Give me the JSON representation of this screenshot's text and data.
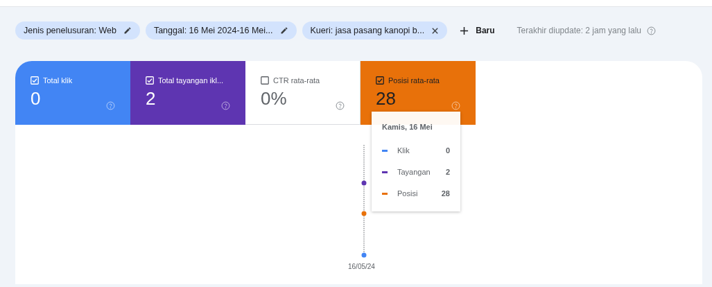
{
  "filters": [
    {
      "label": "Jenis penelusuran: Web",
      "kind": "edit"
    },
    {
      "label": "Tanggal: 16 Mei 2024-16 Mei...",
      "kind": "edit"
    },
    {
      "label": "Kueri: jasa pasang kanopi b...",
      "kind": "remove"
    }
  ],
  "new_button": "Baru",
  "last_updated": "Terakhir diupdate: 2 jam yang lalu",
  "metrics": [
    {
      "label": "Total klik",
      "value": "0",
      "checked": true,
      "color": "#4285f4"
    },
    {
      "label": "Total tayangan ikl...",
      "value": "2",
      "checked": true,
      "color": "#5e35b1"
    },
    {
      "label": "CTR rata-rata",
      "value": "0%",
      "checked": false
    },
    {
      "label": "Posisi rata-rata",
      "value": "28",
      "checked": true,
      "color": "#e8710a"
    }
  ],
  "chart": {
    "x_label": "16/05/24",
    "tooltip": {
      "title": "Kamis, 16 Mei",
      "rows": [
        {
          "name": "Klik",
          "value": "0",
          "color": "#4285f4"
        },
        {
          "name": "Tayangan",
          "value": "2",
          "color": "#5e35b1"
        },
        {
          "name": "Posisi",
          "value": "28",
          "color": "#e8710a"
        }
      ]
    }
  }
}
